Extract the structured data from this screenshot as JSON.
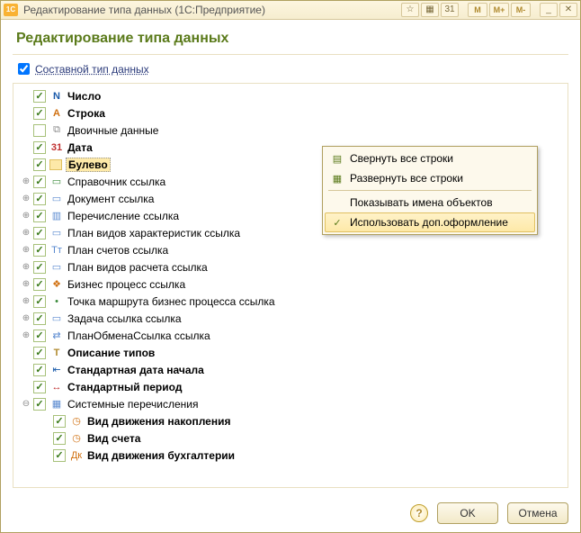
{
  "titlebar": {
    "app_badge": "1C",
    "title": "Редактирование типа данных (1С:Предприятие)",
    "buttons": {
      "star": "☆",
      "calc": "▦",
      "cal": "31",
      "m": "M",
      "mplus": "M+",
      "mminus": "M-",
      "min": "_",
      "close": "✕"
    }
  },
  "heading": "Редактирование типа данных",
  "compound": {
    "label": "Составной тип данных",
    "checked": true
  },
  "tree": [
    {
      "id": "number",
      "level": 0,
      "exp": "none",
      "checked": true,
      "icon_class": "ti-num",
      "icon_glyph": "N",
      "label": "Число",
      "bold": true,
      "selected": false
    },
    {
      "id": "string",
      "level": 0,
      "exp": "none",
      "checked": true,
      "icon_class": "ti-str",
      "icon_glyph": "A",
      "label": "Строка",
      "bold": true,
      "selected": false
    },
    {
      "id": "binary",
      "level": 0,
      "exp": "none",
      "checked": false,
      "icon_class": "ti-bin",
      "icon_glyph": "⧉",
      "label": "Двоичные данные",
      "bold": false,
      "selected": false
    },
    {
      "id": "date",
      "level": 0,
      "exp": "none",
      "checked": true,
      "icon_class": "ti-date",
      "icon_glyph": "31",
      "label": "Дата",
      "bold": true,
      "selected": false
    },
    {
      "id": "boolean",
      "level": 0,
      "exp": "none",
      "checked": true,
      "icon_class": "ti-bool",
      "icon_glyph": "",
      "label": "Булево",
      "bold": true,
      "selected": true
    },
    {
      "id": "catalog",
      "level": 0,
      "exp": "plus",
      "checked": true,
      "icon_class": "ti-ref",
      "icon_glyph": "▭",
      "label": "Справочник ссылка",
      "bold": false,
      "selected": false
    },
    {
      "id": "document",
      "level": 0,
      "exp": "plus",
      "checked": true,
      "icon_class": "ti-doc",
      "icon_glyph": "▭",
      "label": "Документ ссылка",
      "bold": false,
      "selected": false
    },
    {
      "id": "enum",
      "level": 0,
      "exp": "plus",
      "checked": true,
      "icon_class": "ti-enum",
      "icon_glyph": "▥",
      "label": "Перечисление ссылка",
      "bold": false,
      "selected": false
    },
    {
      "id": "chartype",
      "level": 0,
      "exp": "plus",
      "checked": true,
      "icon_class": "ti-plan",
      "icon_glyph": "▭",
      "label": "План видов характеристик ссылка",
      "bold": false,
      "selected": false
    },
    {
      "id": "accounts",
      "level": 0,
      "exp": "plus",
      "checked": true,
      "icon_class": "ti-acc",
      "icon_glyph": "Tт",
      "label": "План счетов ссылка",
      "bold": false,
      "selected": false
    },
    {
      "id": "calckind",
      "level": 0,
      "exp": "plus",
      "checked": true,
      "icon_class": "ti-calc",
      "icon_glyph": "▭",
      "label": "План видов расчета ссылка",
      "bold": false,
      "selected": false
    },
    {
      "id": "bproc",
      "level": 0,
      "exp": "plus",
      "checked": true,
      "icon_class": "ti-bp",
      "icon_glyph": "❖",
      "label": "Бизнес процесс ссылка",
      "bold": false,
      "selected": false
    },
    {
      "id": "route",
      "level": 0,
      "exp": "plus",
      "checked": true,
      "icon_class": "ti-route",
      "icon_glyph": "•",
      "label": "Точка маршрута бизнес процесса ссылка",
      "bold": false,
      "selected": false
    },
    {
      "id": "task",
      "level": 0,
      "exp": "plus",
      "checked": true,
      "icon_class": "ti-task",
      "icon_glyph": "▭",
      "label": "Задача ссылка ссылка",
      "bold": false,
      "selected": false
    },
    {
      "id": "exchange",
      "level": 0,
      "exp": "plus",
      "checked": true,
      "icon_class": "ti-exch",
      "icon_glyph": "⇄",
      "label": "ПланОбменаСсылка ссылка",
      "bold": false,
      "selected": false
    },
    {
      "id": "typedesc",
      "level": 0,
      "exp": "none",
      "checked": true,
      "icon_class": "ti-typed",
      "icon_glyph": "T",
      "label": "Описание типов",
      "bold": true,
      "selected": false
    },
    {
      "id": "stddate",
      "level": 0,
      "exp": "none",
      "checked": true,
      "icon_class": "ti-std",
      "icon_glyph": "⇤",
      "label": "Стандартная дата начала",
      "bold": true,
      "selected": false
    },
    {
      "id": "stdperiod",
      "level": 0,
      "exp": "none",
      "checked": true,
      "icon_class": "ti-period",
      "icon_glyph": "↔",
      "label": "Стандартный период",
      "bold": true,
      "selected": false
    },
    {
      "id": "sysenum",
      "level": 0,
      "exp": "minus",
      "checked": true,
      "icon_class": "ti-sys",
      "icon_glyph": "▦",
      "label": "Системные перечисления",
      "bold": false,
      "selected": false
    },
    {
      "id": "accum",
      "level": 1,
      "exp": "none",
      "checked": true,
      "icon_class": "ti-sub",
      "icon_glyph": "◷",
      "label": "Вид движения накопления",
      "bold": true,
      "selected": false
    },
    {
      "id": "acctype",
      "level": 1,
      "exp": "none",
      "checked": true,
      "icon_class": "ti-sub",
      "icon_glyph": "◷",
      "label": "Вид счета",
      "bold": true,
      "selected": false
    },
    {
      "id": "bookkeep",
      "level": 1,
      "exp": "none",
      "checked": true,
      "icon_class": "ti-sub",
      "icon_glyph": "Дк",
      "label": "Вид движения бухгалтерии",
      "bold": true,
      "selected": false
    }
  ],
  "context_menu": {
    "items": [
      {
        "id": "collapse",
        "icon": "▤",
        "label": "Свернуть все строки",
        "hover": false
      },
      {
        "id": "expand",
        "icon": "▦",
        "label": "Развернуть все строки",
        "hover": false
      },
      {
        "id": "sep",
        "sep": true
      },
      {
        "id": "shownames",
        "icon": "",
        "label": "Показывать имена объектов",
        "hover": false
      },
      {
        "id": "extfmt",
        "icon": "✓",
        "label": "Использовать доп.оформление",
        "hover": true
      }
    ]
  },
  "footer": {
    "help": "?",
    "ok": "OK",
    "cancel": "Отмена"
  }
}
